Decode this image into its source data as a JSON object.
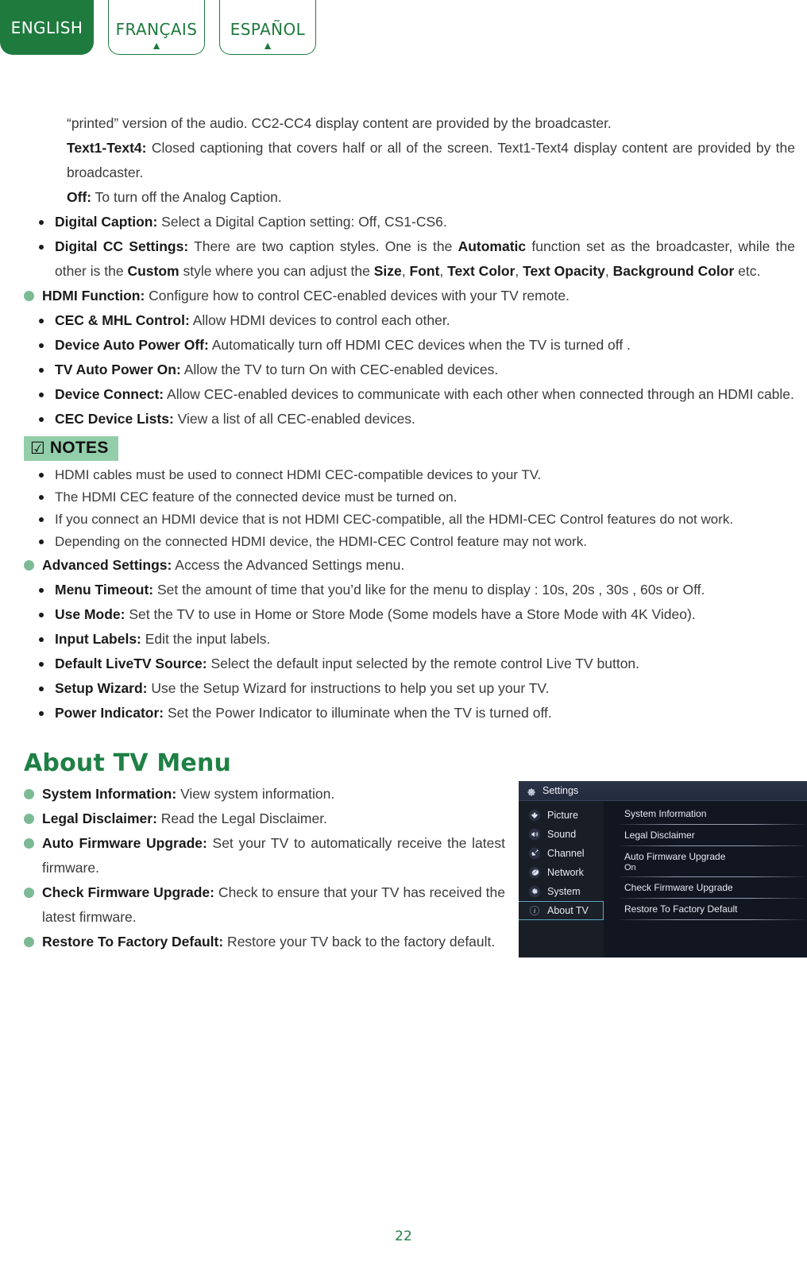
{
  "language_tabs": [
    {
      "label": "ENGLISH",
      "active": true,
      "caret": ""
    },
    {
      "label": "FRANÇAIS",
      "active": false,
      "caret": "▲"
    },
    {
      "label": "ESPAÑOL",
      "active": false,
      "caret": "▲"
    }
  ],
  "colors": {
    "brand_green": "#1f7a3e",
    "heading_green": "#1f8045",
    "bullet_green": "#7cba94",
    "notes_bg": "#93ceaa",
    "tv_panel_bg": "#14181f",
    "tv_header_bg": "#2b3348",
    "tv_selected_border": "#5fa8c4"
  },
  "body": {
    "paragraphs": [
      {
        "id": "printed-version",
        "indent": 1,
        "bold": "",
        "text": "“printed” version of the audio. CC2-CC4 display content are provided by the broadcaster."
      },
      {
        "id": "text1-text4",
        "indent": 1,
        "bold": "Text1-Text4:",
        "text": " Closed captioning that covers half or all of the screen. Text1-Text4 display content are provided by the broadcaster."
      },
      {
        "id": "off",
        "indent": 1,
        "bold": "Off:",
        "text": " To turn off the Analog Caption."
      }
    ],
    "bullets_top": [
      {
        "id": "digital-caption",
        "level": 2,
        "bold": "Digital Caption:",
        "text": " Select a Digital Caption setting: Off, CS1-CS6."
      },
      {
        "id": "digital-cc-settings",
        "level": 2,
        "bold": "Digital CC Settings:",
        "rich": [
          {
            "t": " There are two caption styles. One is the "
          },
          {
            "t": "Automatic",
            "b": true
          },
          {
            "t": " function set as the broadcaster, while the other is the "
          },
          {
            "t": "Custom",
            "b": true
          },
          {
            "t": " style where you can adjust the "
          },
          {
            "t": "Size",
            "b": true
          },
          {
            "t": ", "
          },
          {
            "t": "Font",
            "b": true
          },
          {
            "t": ", "
          },
          {
            "t": "Text Color",
            "b": true
          },
          {
            "t": ", "
          },
          {
            "t": "Text Opacity",
            "b": true
          },
          {
            "t": ", "
          },
          {
            "t": "Background Color",
            "b": true
          },
          {
            "t": " etc."
          }
        ]
      },
      {
        "id": "hdmi-function",
        "level": 1,
        "bold": "HDMI Function:",
        "text": " Configure how to control CEC-enabled devices with your TV remote."
      },
      {
        "id": "cec-mhl-control",
        "level": 2,
        "bold": "CEC & MHL Control:",
        "text": " Allow HDMI devices to control each other."
      },
      {
        "id": "device-auto-power-off",
        "level": 2,
        "bold": "Device Auto Power Off:",
        "text": " Automatically turn off HDMI CEC devices when the TV is turned off ."
      },
      {
        "id": "tv-auto-power-on",
        "level": 2,
        "bold": "TV Auto Power On:",
        "text": " Allow the TV to turn On with CEC-enabled devices."
      },
      {
        "id": "device-connect",
        "level": 2,
        "bold": "Device Connect:",
        "text": " Allow CEC-enabled devices to communicate with each other when connected through an HDMI cable."
      },
      {
        "id": "cec-device-lists",
        "level": 2,
        "bold": "CEC Device Lists:",
        "text": " View a list of all CEC-enabled devices."
      }
    ],
    "notes": {
      "badge_icon": "checked-box-icon",
      "badge_glyph": "☑",
      "label": "NOTES",
      "items": [
        "HDMI cables must be used to connect HDMI CEC-compatible devices to your TV.",
        "The HDMI CEC feature of the connected device must be turned on.",
        "If you connect an HDMI device that is not HDMI CEC-compatible, all the HDMI-CEC Control features do not work.",
        "Depending on the connected HDMI device, the HDMI-CEC Control feature may not work."
      ]
    },
    "bullets_advanced": [
      {
        "id": "advanced-settings",
        "level": 1,
        "bold": "Advanced Settings:",
        "text": " Access the Advanced Settings menu."
      },
      {
        "id": "menu-timeout",
        "level": 2,
        "bold": "Menu Timeout:",
        "text": " Set the amount of time that you’d like for the menu to display : 10s, 20s , 30s , 60s or Off."
      },
      {
        "id": "use-mode",
        "level": 2,
        "bold": "Use Mode:",
        "text": " Set the TV to use in Home or Store Mode (Some models have a Store Mode with 4K Video)."
      },
      {
        "id": "input-labels",
        "level": 2,
        "bold": "Input Labels:",
        "text": " Edit the input labels."
      },
      {
        "id": "default-livetv-source",
        "level": 2,
        "bold": "Default LiveTV Source:",
        "text": " Select the default input selected by the remote control Live TV button."
      },
      {
        "id": "setup-wizard",
        "level": 2,
        "bold": "Setup Wizard:",
        "text": " Use the Setup Wizard for instructions to help you set up your TV."
      },
      {
        "id": "power-indicator",
        "level": 2,
        "bold": "Power Indicator:",
        "text": " Set the Power Indicator to illuminate when the TV is turned off."
      }
    ],
    "section_title": "About TV Menu",
    "bullets_about": [
      {
        "id": "system-information",
        "level": 1,
        "bold": "System Information:",
        "text": " View system information."
      },
      {
        "id": "legal-disclaimer",
        "level": 1,
        "bold": "Legal Disclaimer:",
        "text": " Read the Legal Disclaimer."
      },
      {
        "id": "auto-firmware-upgrade",
        "level": 1,
        "bold": "Auto Firmware Upgrade:",
        "text": " Set your TV to automatically receive the latest firmware."
      },
      {
        "id": "check-firmware-upgrade",
        "level": 1,
        "bold": "Check Firmware Upgrade:",
        "text": " Check to ensure that your TV has received the latest firmware."
      },
      {
        "id": "restore-to-factory-default",
        "level": 1,
        "bold": "Restore To Factory Default:",
        "text": " Restore your TV back to the factory default."
      }
    ]
  },
  "tv_panel": {
    "header": {
      "icon": "gear-icon",
      "title": "Settings"
    },
    "sidebar": [
      {
        "icon": "picture-icon",
        "label": "Picture",
        "selected": false
      },
      {
        "icon": "speaker-icon",
        "label": "Sound",
        "selected": false
      },
      {
        "icon": "satellite-dish-icon",
        "label": "Channel",
        "selected": false
      },
      {
        "icon": "network-globe-icon",
        "label": "Network",
        "selected": false
      },
      {
        "icon": "gear-icon",
        "label": "System",
        "selected": false
      },
      {
        "icon": "info-icon",
        "label": "About TV",
        "selected": true
      }
    ],
    "options": [
      {
        "name": "System Information",
        "value": ""
      },
      {
        "name": "Legal Disclaimer",
        "value": ""
      },
      {
        "name": "Auto Firmware Upgrade",
        "value": "On"
      },
      {
        "name": "Check Firmware Upgrade",
        "value": ""
      },
      {
        "name": "Restore To Factory Default",
        "value": ""
      }
    ]
  },
  "footer": {
    "page_number": "22"
  }
}
